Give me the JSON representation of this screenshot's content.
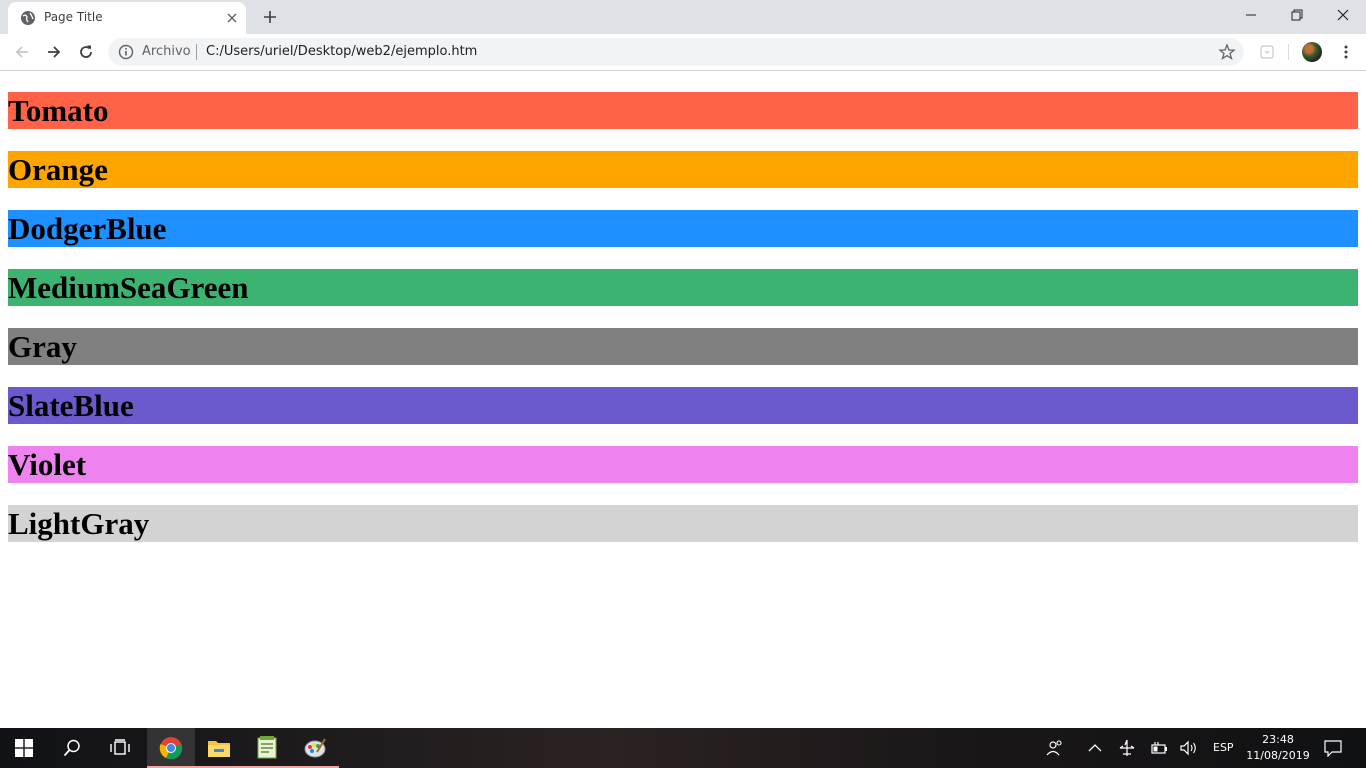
{
  "browser": {
    "tab_title": "Page Title",
    "scheme_label": "Archivo",
    "url": "C:/Users/uriel/Desktop/web2/ejemplo.htm"
  },
  "headings": [
    {
      "text": "Tomato",
      "color": "#ff6347"
    },
    {
      "text": "Orange",
      "color": "#ffa500"
    },
    {
      "text": "DodgerBlue",
      "color": "#1e90ff"
    },
    {
      "text": "MediumSeaGreen",
      "color": "#3cb371"
    },
    {
      "text": "Gray",
      "color": "#808080"
    },
    {
      "text": "SlateBlue",
      "color": "#6a5acd"
    },
    {
      "text": "Violet",
      "color": "#ee82ee"
    },
    {
      "text": "LightGray",
      "color": "#d3d3d3"
    }
  ],
  "taskbar": {
    "language": "ESP",
    "time": "23:48",
    "date": "11/08/2019"
  }
}
